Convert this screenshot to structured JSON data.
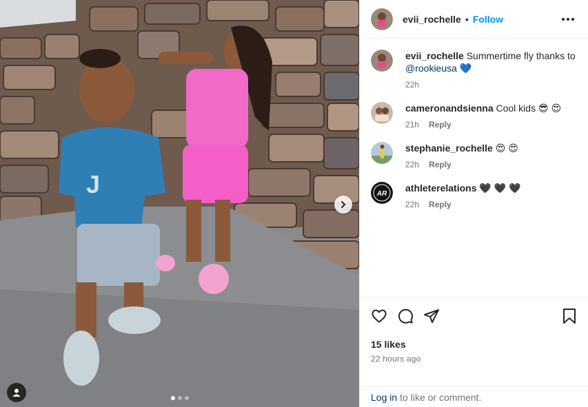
{
  "post": {
    "author": "evii_rochelle",
    "separator": "•",
    "follow_label": "Follow",
    "carousel_dots": 3,
    "active_dot": 0
  },
  "comments": [
    {
      "user": "evii_rochelle",
      "text_before": "Summertime fly thanks to ",
      "mention": "@rookieusa",
      "emoji": "💙",
      "time": "22h",
      "reply": ""
    },
    {
      "user": "cameronandsienna",
      "text_before": "Cool kids ",
      "mention": "",
      "emoji": "😎 😍",
      "time": "21h",
      "reply": "Reply"
    },
    {
      "user": "stephanie_rochelle",
      "text_before": "",
      "mention": "",
      "emoji": "😍 😍",
      "time": "22h",
      "reply": "Reply"
    },
    {
      "user": "athleterelations",
      "text_before": "",
      "mention": "",
      "emoji": "🖤 🖤 🖤",
      "time": "22h",
      "reply": "Reply",
      "avatar_text": "AR"
    }
  ],
  "actions": {
    "likes": "15 likes",
    "posted": "22 hours ago"
  },
  "login_bar": {
    "login": "Log in",
    "rest": "to like or comment."
  },
  "colors": {
    "link_blue": "#0095f6",
    "mention_blue": "#00376b",
    "muted": "#737373"
  }
}
